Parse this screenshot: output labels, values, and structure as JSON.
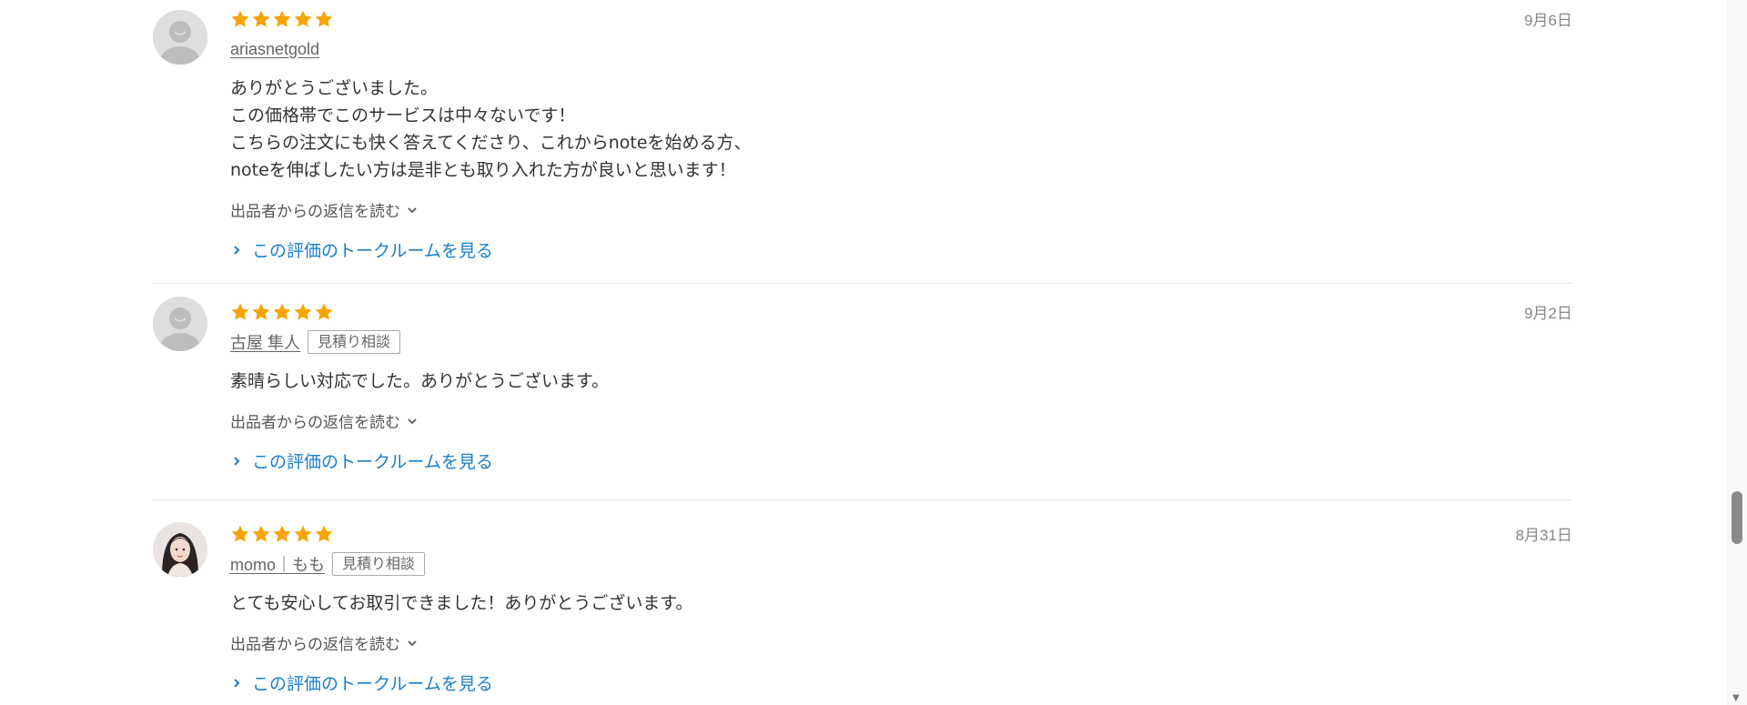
{
  "reviews": [
    {
      "rating": 5,
      "date": "9月6日",
      "username": "ariasnetgold",
      "badge": "",
      "avatar": "default-avatar",
      "comment_lines": [
        "ありがとうございました。",
        "この価格帯でこのサービスは中々ないです！",
        "こちらの注文にも快く答えてくださり、これからnoteを始める方、",
        "noteを伸ばしたい方は是非とも取り入れた方が良いと思います！"
      ],
      "reply_toggle": "出品者からの返信を読む",
      "talkroom_link": "この評価のトークルームを見る"
    },
    {
      "rating": 5,
      "date": "9月2日",
      "username": "古屋 隼人",
      "badge": "見積り相談",
      "avatar": "default-avatar",
      "comment_lines": [
        "素晴らしい対応でした。ありがとうございます。"
      ],
      "reply_toggle": "出品者からの返信を読む",
      "talkroom_link": "この評価のトークルームを見る"
    },
    {
      "rating": 5,
      "date": "8月31日",
      "username": "momo｜もも",
      "badge": "見積り相談",
      "avatar": "photo-avatar",
      "comment_lines": [
        "とても安心してお取引できました！ありがとうございます。"
      ],
      "reply_toggle": "出品者からの返信を読む",
      "talkroom_link": "この評価のトークルームを見る"
    }
  ],
  "colors": {
    "star": "#f7a400",
    "link": "#1a7fc8",
    "divider": "#e5e5e5"
  },
  "icons": {
    "star": "star-icon",
    "chevron_down": "chevron-down-icon",
    "chevron_right": "chevron-right-icon"
  }
}
